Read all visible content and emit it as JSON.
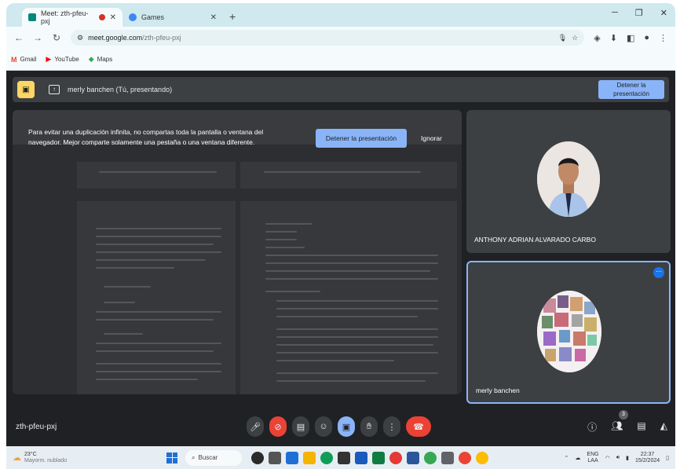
{
  "browser": {
    "tabs": [
      {
        "label": "Meet: zth-pfeu-pxj",
        "recording": true
      },
      {
        "label": "Games",
        "recording": false
      }
    ],
    "new_tab_glyph": "+",
    "url_host": "meet.google.com",
    "url_path": "/zth-pfeu-pxj",
    "bookmarks": [
      {
        "label": "Gmail",
        "icon": "gmail-icon"
      },
      {
        "label": "YouTube",
        "icon": "youtube-icon"
      },
      {
        "label": "Maps",
        "icon": "maps-icon"
      }
    ]
  },
  "meet": {
    "presenting_label": "merly banchen (Tú, presentando)",
    "stop_top_label": "Detener la presentación",
    "warning_text": "Para evitar una duplicación infinita, no compartas toda la pantalla o ventana del navegador. Mejor comparte solamente una pestaña o una ventana diferente.",
    "stop_button_label": "Detener la presentación",
    "ignore_button_label": "Ignorar",
    "participants": [
      {
        "name": "ANTHONY ADRIAN ALVARADO CARBO"
      },
      {
        "name": "merly banchen"
      }
    ],
    "meeting_code": "zth-pfeu-pxj",
    "people_count": "3",
    "colors": {
      "background": "#202124",
      "tile": "#3c4043",
      "accent_blue": "#8ab4f8",
      "end_call_red": "#ea4335",
      "presenting_yellow": "#fdd663"
    }
  },
  "taskbar": {
    "temperature": "23°C",
    "weather_desc": "Mayorm. nublado",
    "search_label": "Buscar",
    "language_top": "ENG",
    "language_bottom": "LAA",
    "time": "22:37",
    "date": "15/2/2024"
  }
}
